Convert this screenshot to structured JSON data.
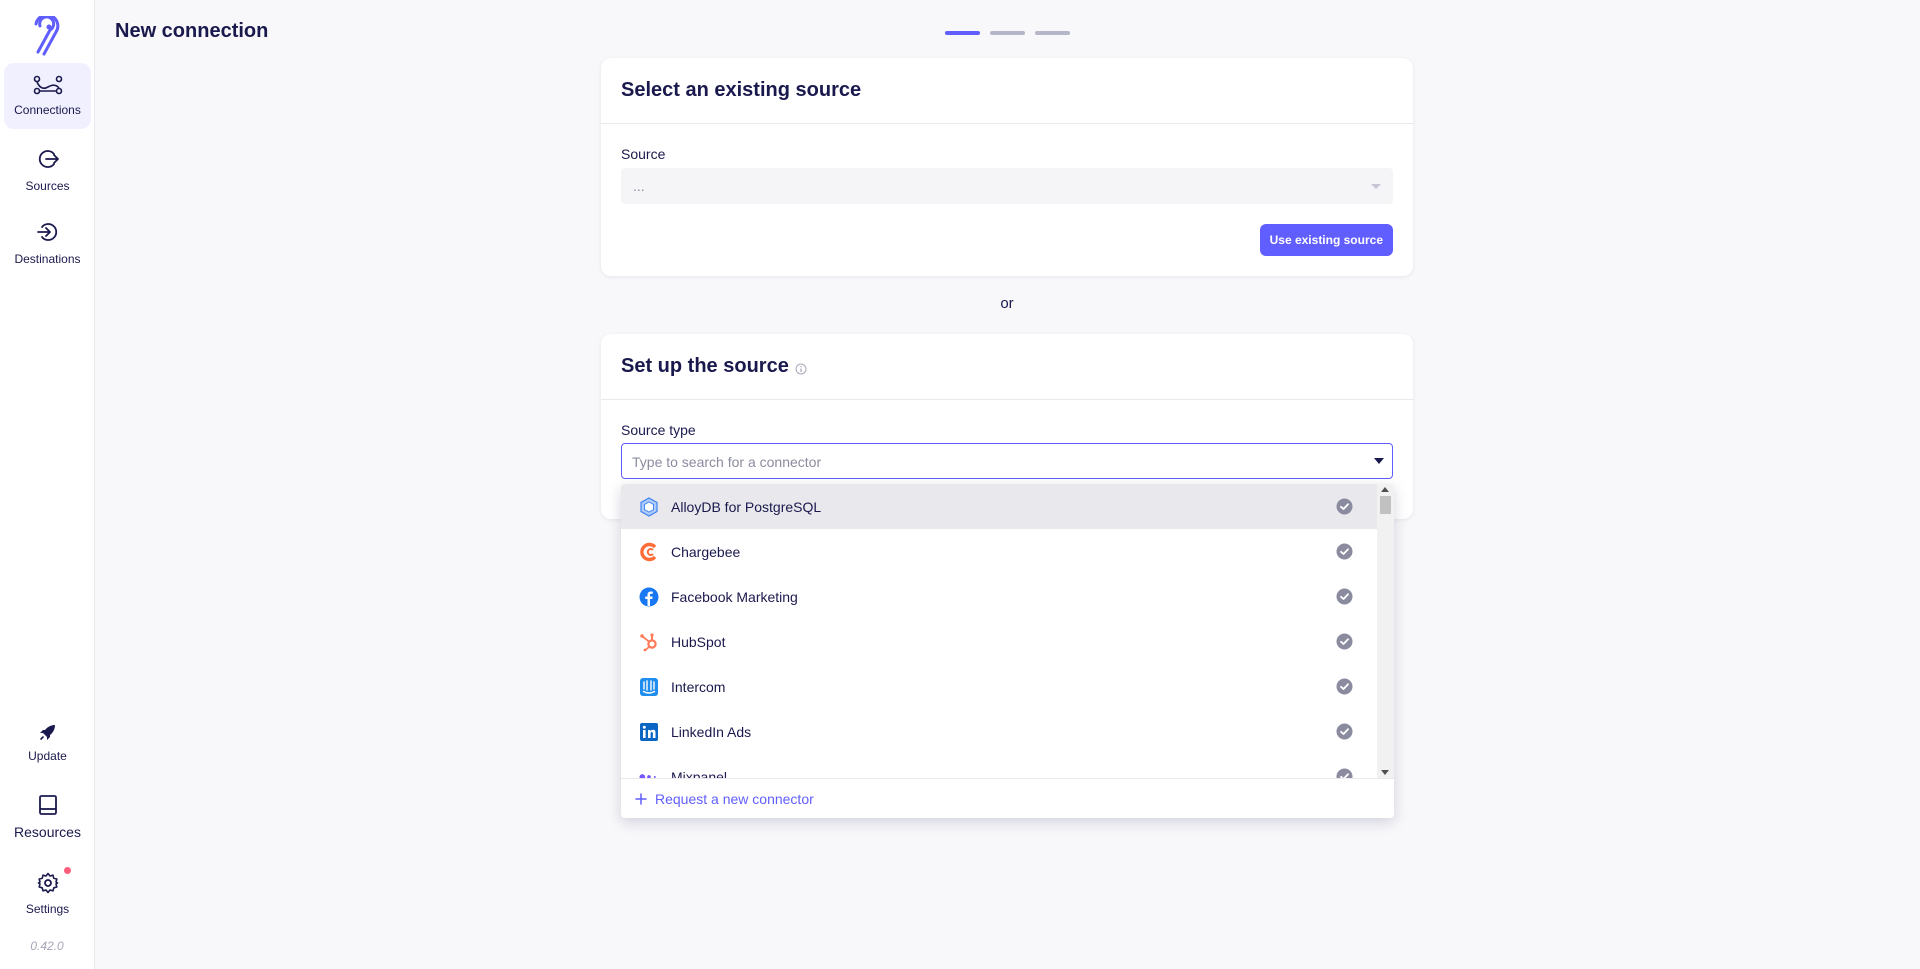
{
  "sidebar": {
    "items": [
      {
        "label": "Connections",
        "icon": "connections-icon",
        "active": true
      },
      {
        "label": "Sources",
        "icon": "sources-icon"
      },
      {
        "label": "Destinations",
        "icon": "destinations-icon"
      }
    ],
    "bottom": [
      {
        "label": "Update",
        "icon": "rocket-icon"
      },
      {
        "label": "Resources",
        "icon": "book-icon"
      },
      {
        "label": "Settings",
        "icon": "gear-icon",
        "badge": true
      }
    ],
    "version": "0.42.0"
  },
  "header": {
    "title": "New connection",
    "steps": 3,
    "active_step": 1
  },
  "existing_source": {
    "title": "Select an existing source",
    "field_label": "Source",
    "select_value": "...",
    "button_label": "Use existing source"
  },
  "separator": "or",
  "setup_source": {
    "title": "Set up the source",
    "field_label": "Source type",
    "placeholder": "Type to search for a connector"
  },
  "dropdown": {
    "options": [
      {
        "label": "AlloyDB for PostgreSQL",
        "icon": "alloydb-icon"
      },
      {
        "label": "Chargebee",
        "icon": "chargebee-icon"
      },
      {
        "label": "Facebook Marketing",
        "icon": "facebook-icon"
      },
      {
        "label": "HubSpot",
        "icon": "hubspot-icon"
      },
      {
        "label": "Intercom",
        "icon": "intercom-icon"
      },
      {
        "label": "LinkedIn Ads",
        "icon": "linkedin-icon"
      },
      {
        "label": "Mixpanel",
        "icon": "mixpanel-icon"
      }
    ],
    "request_label": "Request a new connector"
  },
  "colors": {
    "accent": "#615eff",
    "text": "#1a194d",
    "badge": "#ff5e7b"
  }
}
